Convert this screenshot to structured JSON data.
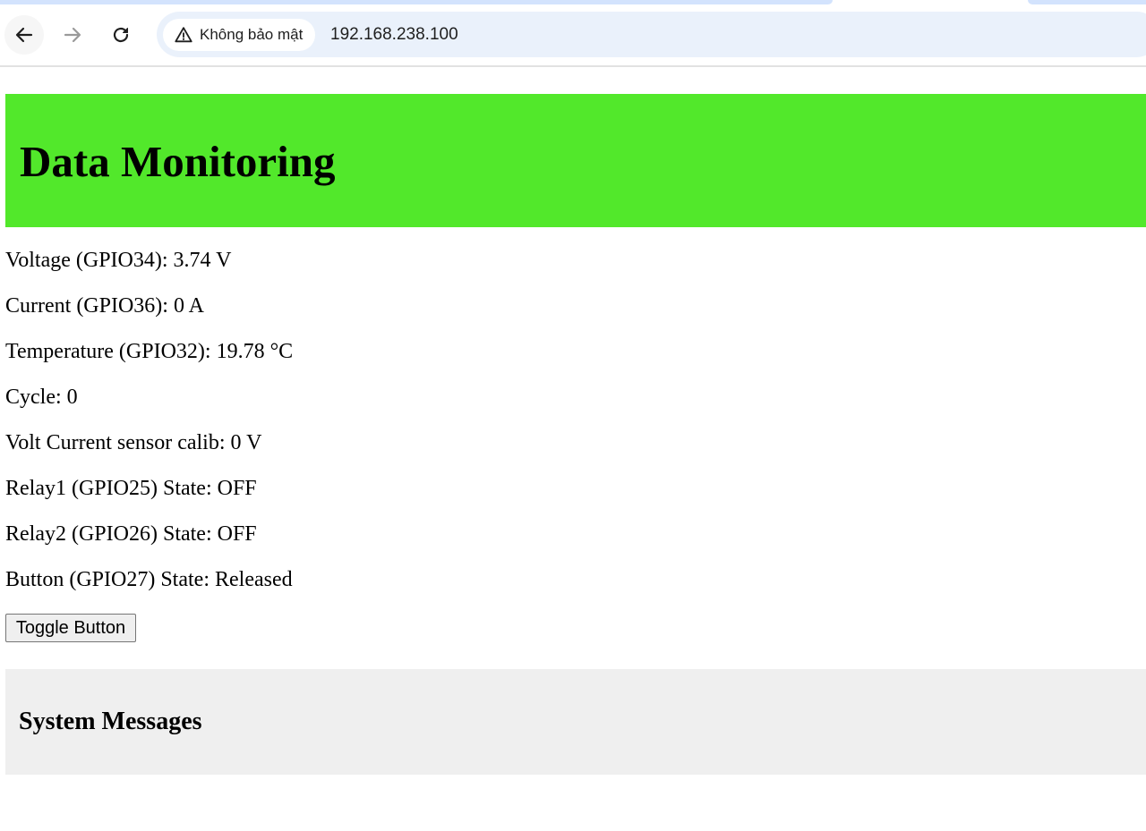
{
  "browser": {
    "security_label": "Không bảo mật",
    "url": "192.168.238.100",
    "icons": {
      "back": "back-arrow-icon",
      "forward": "forward-arrow-icon",
      "reload": "reload-icon",
      "security": "warning-triangle-icon"
    }
  },
  "header": {
    "title": "Data Monitoring",
    "background_color": "#52e82b"
  },
  "readings": [
    "Voltage (GPIO34): 3.74 V",
    "Current (GPIO36): 0 A",
    "Temperature (GPIO32): 19.78 °C",
    "Cycle: 0",
    "Volt Current sensor calib: 0 V",
    "Relay1 (GPIO25) State: OFF",
    "Relay2 (GPIO26) State: OFF",
    "Button (GPIO27) State: Released"
  ],
  "controls": {
    "toggle_label": "Toggle Button"
  },
  "messages": {
    "title": "System Messages",
    "background_color": "#efefef"
  }
}
